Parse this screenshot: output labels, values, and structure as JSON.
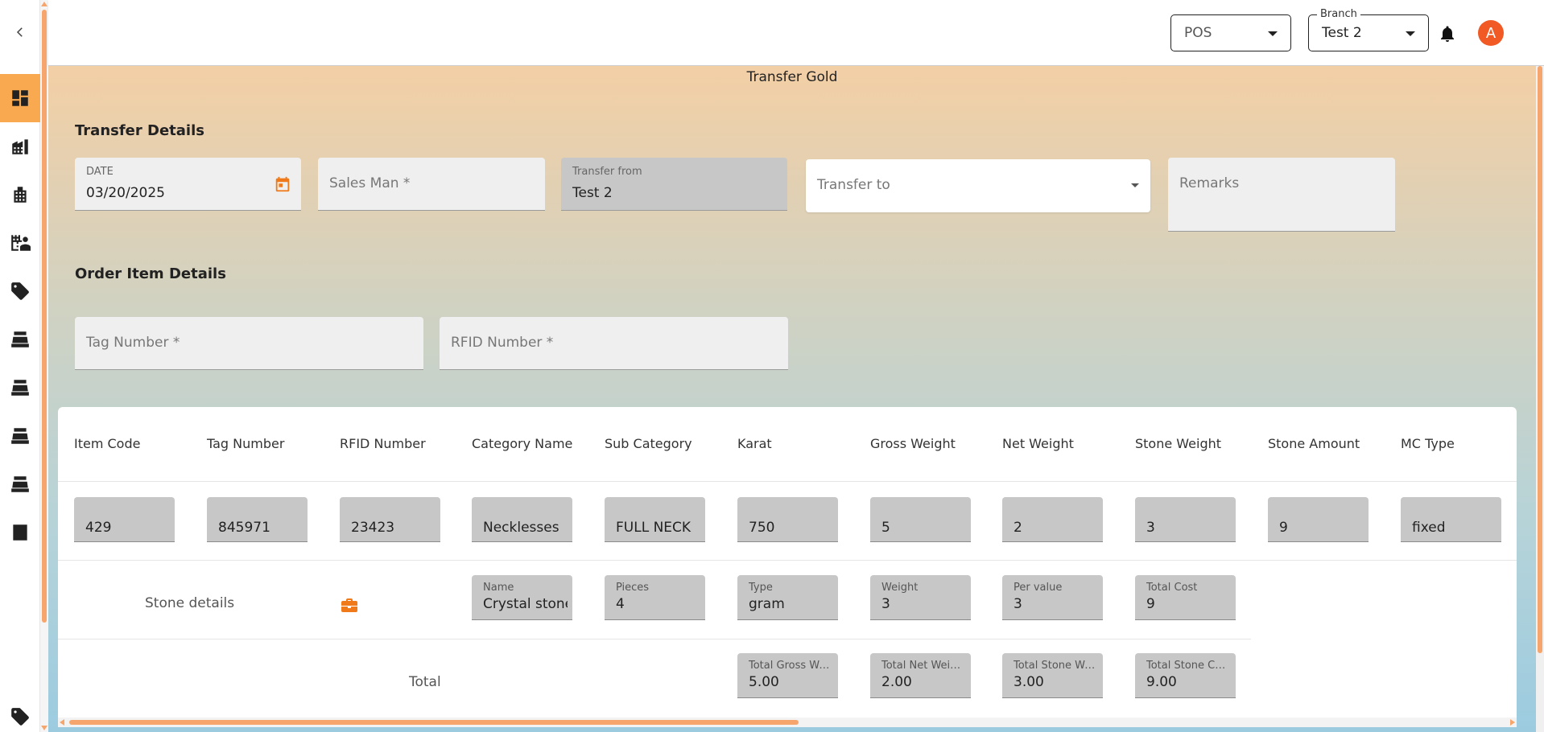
{
  "topbar": {
    "mode_select": {
      "value": "POS"
    },
    "branch_select": {
      "label": "Branch",
      "value": "Test 2"
    },
    "avatar_initial": "A"
  },
  "page": {
    "title": "Transfer Gold"
  },
  "transfer_details": {
    "title": "Transfer Details",
    "date": {
      "label": "DATE",
      "value": "03/20/2025"
    },
    "sales_man": {
      "placeholder": "Sales Man *"
    },
    "transfer_from": {
      "label": "Transfer from",
      "value": "Test 2"
    },
    "transfer_to": {
      "placeholder": "Transfer to"
    },
    "remarks": {
      "placeholder": "Remarks"
    }
  },
  "order_item_details": {
    "title": "Order Item Details",
    "tag_number": {
      "placeholder": "Tag Number *"
    },
    "rfid_number": {
      "placeholder": "RFID Number *"
    }
  },
  "table": {
    "headers": [
      "Item Code",
      "Tag Number",
      "RFID Number",
      "Category Name",
      "Sub Category",
      "Karat",
      "Gross Weight",
      "Net Weight",
      "Stone Weight",
      "Stone Amount",
      "MC Type"
    ],
    "row": [
      "429",
      "845971",
      "23423",
      "Necklesses",
      "FULL NECK",
      "750",
      "5",
      "2",
      "3",
      "9",
      "fixed"
    ],
    "stone_details": {
      "label": "Stone details",
      "fields": [
        {
          "label": "Name",
          "value": "Crystal stone"
        },
        {
          "label": "Pieces",
          "value": "4"
        },
        {
          "label": "Type",
          "value": "gram"
        },
        {
          "label": "Weight",
          "value": "3"
        },
        {
          "label": "Per value",
          "value": "3"
        },
        {
          "label": "Total Cost",
          "value": "9"
        }
      ]
    },
    "total": {
      "label": "Total",
      "fields": [
        {
          "label": "Total Gross Weight",
          "value": "5.00"
        },
        {
          "label": "Total Net Weight",
          "value": "2.00"
        },
        {
          "label": "Total Stone Weight",
          "value": "3.00"
        },
        {
          "label": "Total Stone Cost",
          "value": "9.00"
        }
      ]
    }
  },
  "colors": {
    "accent": "#f9a94f",
    "avatar": "#f15a24",
    "icon_orange": "#f07a1a"
  }
}
